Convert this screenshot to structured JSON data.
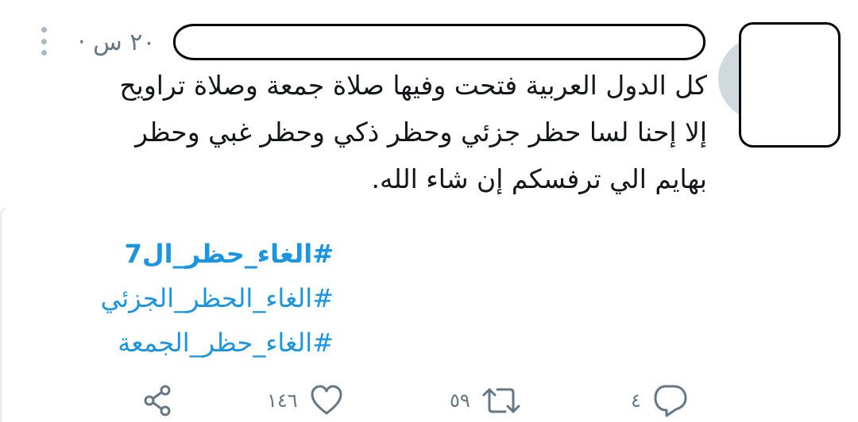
{
  "tweet": {
    "time": "٢٠ س ·",
    "text_lines": [
      "كل الدول العربية فتحت وفيها صلاة جمعة وصلاة تراويح",
      "إلا إحنا لسا حظر جزئي وحظر ذكي وحظر غبي وحظر",
      "بهايم الي ترفسكم إن شاء الله."
    ],
    "hashtags": [
      "#الغاء_حظر_ال7",
      "#الغاء_الحظر_الجزئي",
      "#الغاء_حظر_الجمعة"
    ]
  },
  "actions": {
    "reply_count": "٤",
    "retweet_count": "٥٩",
    "like_count": "١٤٦"
  },
  "icons": {
    "more": "more-vertical-icon",
    "reply": "reply-icon",
    "retweet": "retweet-icon",
    "like": "heart-icon",
    "share": "share-icon"
  },
  "colors": {
    "hashtag": "#1b95e0",
    "muted": "#657786",
    "icon": "#657786"
  }
}
